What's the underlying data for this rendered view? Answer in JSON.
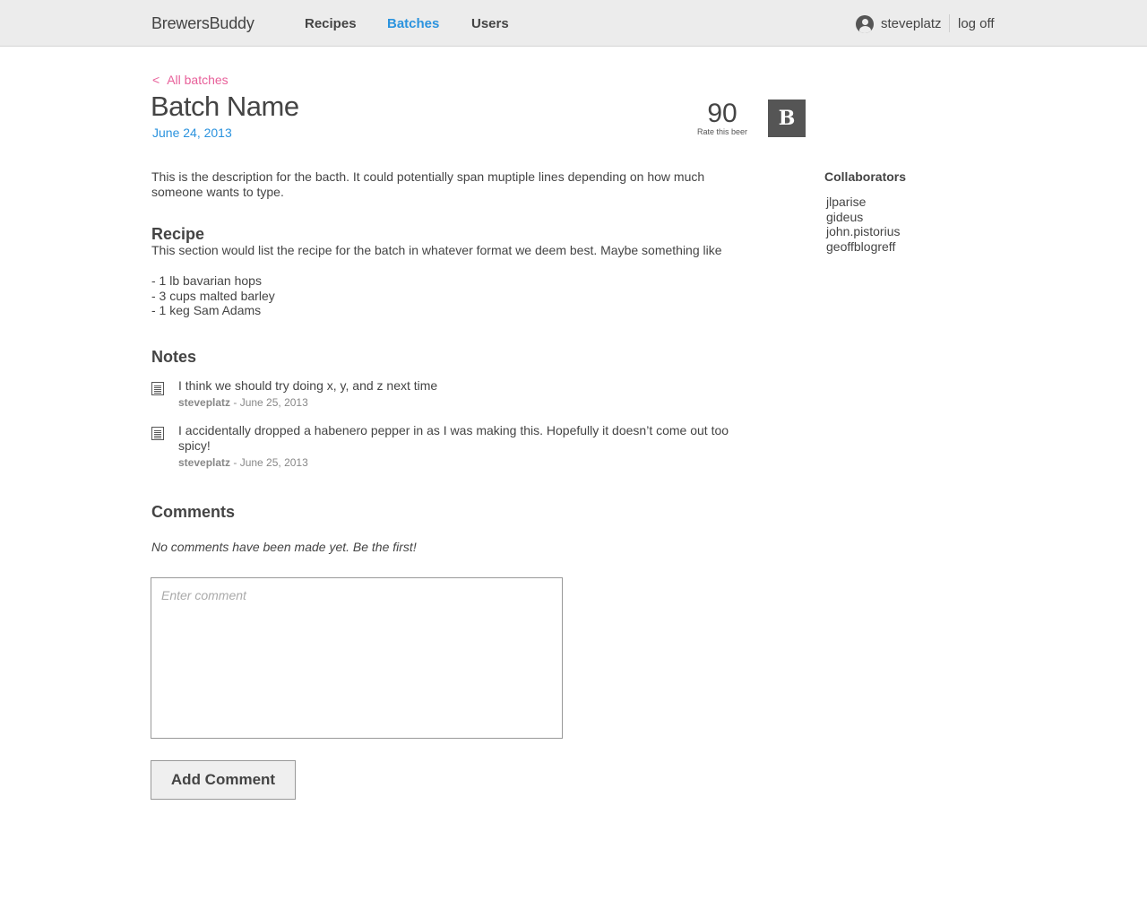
{
  "nav": {
    "brand": "BrewersBuddy",
    "links": [
      "Recipes",
      "Batches",
      "Users"
    ],
    "active": "Batches",
    "username": "steveplatz",
    "logoff": "log off"
  },
  "header": {
    "back_chevron": "<",
    "back_label": "All batches",
    "title": "Batch Name",
    "date": "June 24, 2013",
    "rating_value": "90",
    "rating_label": "Rate this beer",
    "badge_letter": "B"
  },
  "description": "This is the description for the bacth. It could potentially span muptiple lines depending on how much someone wants to type.",
  "recipe": {
    "heading": "Recipe",
    "intro": "This section would list the recipe for the batch in whatever format we deem best. Maybe something like",
    "ingredients": [
      "- 1 lb bavarian hops",
      "- 3 cups malted barley",
      "- 1 keg Sam Adams"
    ]
  },
  "notes": {
    "heading": "Notes",
    "items": [
      {
        "text": "I think we should try doing x, y, and z next time",
        "author": "steveplatz",
        "date": " - June 25, 2013"
      },
      {
        "text": "I accidentally dropped a habenero pepper in as I was making this. Hopefully it doesn’t come out too spicy!",
        "author": "steveplatz",
        "date": " - June 25, 2013"
      }
    ]
  },
  "comments": {
    "heading": "Comments",
    "empty_message": "No comments have been made yet. Be the first!",
    "input_placeholder": "Enter comment",
    "input_value": "",
    "submit_label": "Add Comment"
  },
  "collaborators": {
    "heading": "Collaborators",
    "names": [
      "jlparise",
      "gideus",
      "john.pistorius",
      "geoffblogreff"
    ]
  },
  "colors": {
    "nav_active": "#2b93de",
    "back_link": "#e8609a",
    "date": "#2b93de",
    "badge_bg": "#555555"
  },
  "icons": {
    "user": "user-avatar-icon",
    "note": "note-document-icon"
  }
}
